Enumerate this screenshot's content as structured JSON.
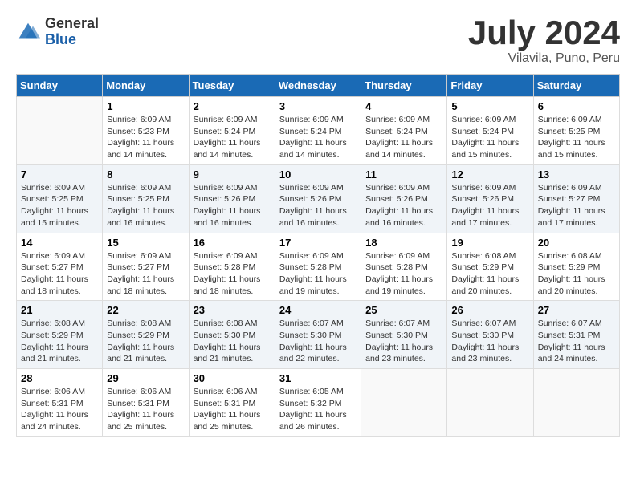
{
  "header": {
    "logo": {
      "general": "General",
      "blue": "Blue"
    },
    "title": "July 2024",
    "location": "Vilavila, Puno, Peru"
  },
  "days_of_week": [
    "Sunday",
    "Monday",
    "Tuesday",
    "Wednesday",
    "Thursday",
    "Friday",
    "Saturday"
  ],
  "weeks": [
    [
      {
        "day": "",
        "info": ""
      },
      {
        "day": "1",
        "info": "Sunrise: 6:09 AM\nSunset: 5:23 PM\nDaylight: 11 hours\nand 14 minutes."
      },
      {
        "day": "2",
        "info": "Sunrise: 6:09 AM\nSunset: 5:24 PM\nDaylight: 11 hours\nand 14 minutes."
      },
      {
        "day": "3",
        "info": "Sunrise: 6:09 AM\nSunset: 5:24 PM\nDaylight: 11 hours\nand 14 minutes."
      },
      {
        "day": "4",
        "info": "Sunrise: 6:09 AM\nSunset: 5:24 PM\nDaylight: 11 hours\nand 14 minutes."
      },
      {
        "day": "5",
        "info": "Sunrise: 6:09 AM\nSunset: 5:24 PM\nDaylight: 11 hours\nand 15 minutes."
      },
      {
        "day": "6",
        "info": "Sunrise: 6:09 AM\nSunset: 5:25 PM\nDaylight: 11 hours\nand 15 minutes."
      }
    ],
    [
      {
        "day": "7",
        "info": "Sunrise: 6:09 AM\nSunset: 5:25 PM\nDaylight: 11 hours\nand 15 minutes."
      },
      {
        "day": "8",
        "info": "Sunrise: 6:09 AM\nSunset: 5:25 PM\nDaylight: 11 hours\nand 16 minutes."
      },
      {
        "day": "9",
        "info": "Sunrise: 6:09 AM\nSunset: 5:26 PM\nDaylight: 11 hours\nand 16 minutes."
      },
      {
        "day": "10",
        "info": "Sunrise: 6:09 AM\nSunset: 5:26 PM\nDaylight: 11 hours\nand 16 minutes."
      },
      {
        "day": "11",
        "info": "Sunrise: 6:09 AM\nSunset: 5:26 PM\nDaylight: 11 hours\nand 16 minutes."
      },
      {
        "day": "12",
        "info": "Sunrise: 6:09 AM\nSunset: 5:26 PM\nDaylight: 11 hours\nand 17 minutes."
      },
      {
        "day": "13",
        "info": "Sunrise: 6:09 AM\nSunset: 5:27 PM\nDaylight: 11 hours\nand 17 minutes."
      }
    ],
    [
      {
        "day": "14",
        "info": "Sunrise: 6:09 AM\nSunset: 5:27 PM\nDaylight: 11 hours\nand 18 minutes."
      },
      {
        "day": "15",
        "info": "Sunrise: 6:09 AM\nSunset: 5:27 PM\nDaylight: 11 hours\nand 18 minutes."
      },
      {
        "day": "16",
        "info": "Sunrise: 6:09 AM\nSunset: 5:28 PM\nDaylight: 11 hours\nand 18 minutes."
      },
      {
        "day": "17",
        "info": "Sunrise: 6:09 AM\nSunset: 5:28 PM\nDaylight: 11 hours\nand 19 minutes."
      },
      {
        "day": "18",
        "info": "Sunrise: 6:09 AM\nSunset: 5:28 PM\nDaylight: 11 hours\nand 19 minutes."
      },
      {
        "day": "19",
        "info": "Sunrise: 6:08 AM\nSunset: 5:29 PM\nDaylight: 11 hours\nand 20 minutes."
      },
      {
        "day": "20",
        "info": "Sunrise: 6:08 AM\nSunset: 5:29 PM\nDaylight: 11 hours\nand 20 minutes."
      }
    ],
    [
      {
        "day": "21",
        "info": "Sunrise: 6:08 AM\nSunset: 5:29 PM\nDaylight: 11 hours\nand 21 minutes."
      },
      {
        "day": "22",
        "info": "Sunrise: 6:08 AM\nSunset: 5:29 PM\nDaylight: 11 hours\nand 21 minutes."
      },
      {
        "day": "23",
        "info": "Sunrise: 6:08 AM\nSunset: 5:30 PM\nDaylight: 11 hours\nand 21 minutes."
      },
      {
        "day": "24",
        "info": "Sunrise: 6:07 AM\nSunset: 5:30 PM\nDaylight: 11 hours\nand 22 minutes."
      },
      {
        "day": "25",
        "info": "Sunrise: 6:07 AM\nSunset: 5:30 PM\nDaylight: 11 hours\nand 23 minutes."
      },
      {
        "day": "26",
        "info": "Sunrise: 6:07 AM\nSunset: 5:30 PM\nDaylight: 11 hours\nand 23 minutes."
      },
      {
        "day": "27",
        "info": "Sunrise: 6:07 AM\nSunset: 5:31 PM\nDaylight: 11 hours\nand 24 minutes."
      }
    ],
    [
      {
        "day": "28",
        "info": "Sunrise: 6:06 AM\nSunset: 5:31 PM\nDaylight: 11 hours\nand 24 minutes."
      },
      {
        "day": "29",
        "info": "Sunrise: 6:06 AM\nSunset: 5:31 PM\nDaylight: 11 hours\nand 25 minutes."
      },
      {
        "day": "30",
        "info": "Sunrise: 6:06 AM\nSunset: 5:31 PM\nDaylight: 11 hours\nand 25 minutes."
      },
      {
        "day": "31",
        "info": "Sunrise: 6:05 AM\nSunset: 5:32 PM\nDaylight: 11 hours\nand 26 minutes."
      },
      {
        "day": "",
        "info": ""
      },
      {
        "day": "",
        "info": ""
      },
      {
        "day": "",
        "info": ""
      }
    ]
  ]
}
